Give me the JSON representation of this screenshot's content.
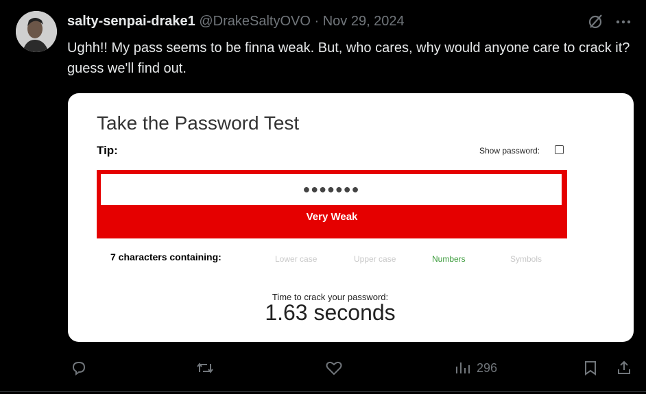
{
  "tweet": {
    "author_name": "salty-senpai-drake1",
    "handle": "@DrakeSaltyOVO",
    "separator": "·",
    "date": "Nov 29, 2024",
    "text": "Ughh!! My pass seems to be finna weak. But, who cares, why would anyone care to crack it? guess we'll find out."
  },
  "card": {
    "title": "Take the Password Test",
    "tip_label": "Tip:",
    "show_password_label": "Show password:",
    "password_masked": "●●●●●●●",
    "strength_label": "Very Weak",
    "characters_label": "7 characters containing:",
    "criteria": [
      {
        "label": "Lower case",
        "met": false
      },
      {
        "label": "Upper case",
        "met": false
      },
      {
        "label": "Numbers",
        "met": true
      },
      {
        "label": "Symbols",
        "met": false
      }
    ],
    "crack_time_label": "Time to crack your password:",
    "crack_time_value": "1.63 seconds"
  },
  "actions": {
    "views": "296"
  },
  "colors": {
    "strength_red": "#e50000",
    "met_green": "#3a9b3a",
    "muted": "#71767b"
  }
}
